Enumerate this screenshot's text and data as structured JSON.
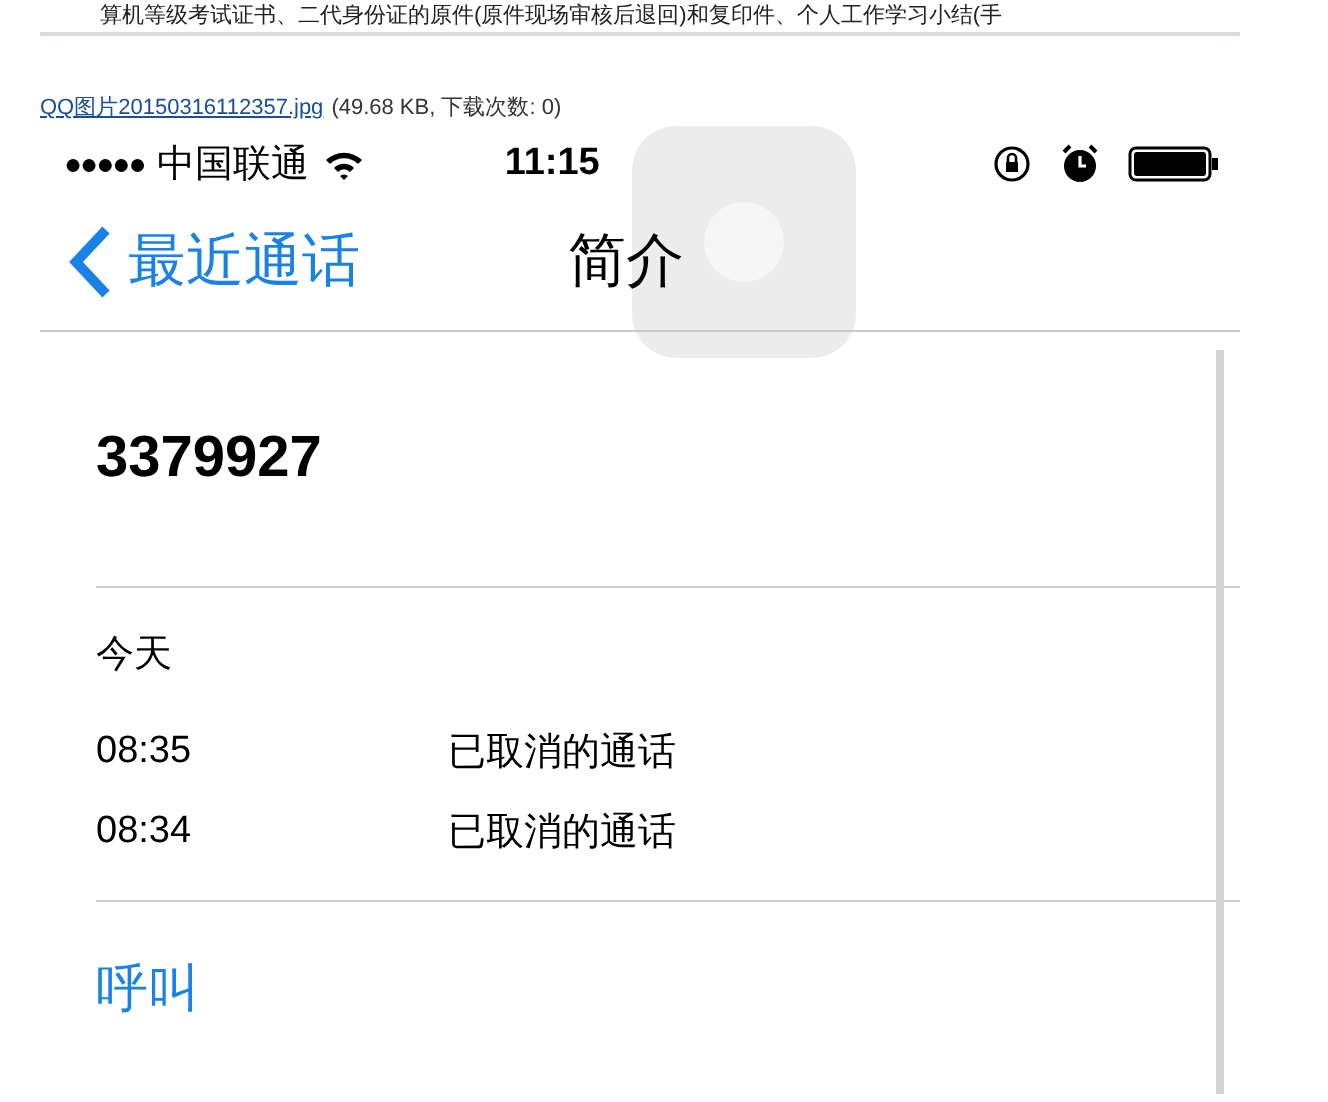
{
  "post_text": "算机等级考试证书、二代身份证的原件(原件现场审核后退回)和复印件、个人工作学习小结(手",
  "attachment": {
    "filename": "QQ图片20150316112357.jpg",
    "info": "(49.68 KB, 下载次数: 0)"
  },
  "phone": {
    "status_bar": {
      "signal": "●●●●●",
      "carrier": "中国联通",
      "time": "11:15"
    },
    "nav": {
      "back": "最近通话",
      "title": "简介"
    },
    "number": "3379927",
    "section": "今天",
    "calls": [
      {
        "time": "08:35",
        "status": "已取消的通话"
      },
      {
        "time": "08:34",
        "status": "已取消的通话"
      }
    ],
    "action": "呼叫"
  }
}
